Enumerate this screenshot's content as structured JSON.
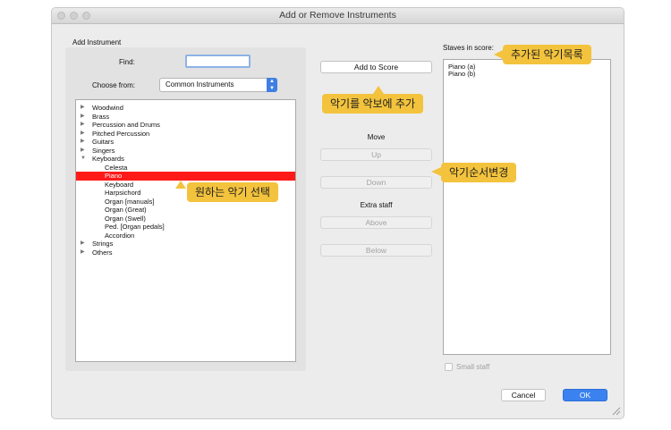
{
  "window": {
    "title": "Add or Remove Instruments"
  },
  "add_instrument": {
    "heading": "Add Instrument",
    "find_label": "Find:",
    "find_value": "",
    "choose_label": "Choose from:",
    "choose_value": "Common Instruments"
  },
  "tree": {
    "items": [
      {
        "label": "Woodwind",
        "level": 0,
        "expanded": false
      },
      {
        "label": "Brass",
        "level": 0,
        "expanded": false
      },
      {
        "label": "Percussion and Drums",
        "level": 0,
        "expanded": false
      },
      {
        "label": "Pitched Percussion",
        "level": 0,
        "expanded": false
      },
      {
        "label": "Guitars",
        "level": 0,
        "expanded": false
      },
      {
        "label": "Singers",
        "level": 0,
        "expanded": false
      },
      {
        "label": "Keyboards",
        "level": 0,
        "expanded": true
      },
      {
        "label": "Celesta",
        "level": 1
      },
      {
        "label": "Piano",
        "level": 1,
        "selected": true
      },
      {
        "label": "Keyboard",
        "level": 1
      },
      {
        "label": "Harpsichord",
        "level": 1
      },
      {
        "label": "Organ [manuals]",
        "level": 1
      },
      {
        "label": "Organ (Great)",
        "level": 1
      },
      {
        "label": "Organ (Swell)",
        "level": 1
      },
      {
        "label": "Ped. [Organ pedals]",
        "level": 1
      },
      {
        "label": "Accordion",
        "level": 1
      },
      {
        "label": "Strings",
        "level": 0,
        "expanded": false
      },
      {
        "label": "Others",
        "level": 0,
        "expanded": false
      }
    ]
  },
  "middle": {
    "add_to_score": "Add to Score",
    "move_label": "Move",
    "up": "Up",
    "down": "Down",
    "extra_staff_label": "Extra staff",
    "above": "Above",
    "below": "Below"
  },
  "staves": {
    "heading": "Staves in score:",
    "items": [
      "Piano (a)",
      "Piano (b)"
    ],
    "small_staff_label": "Small staff",
    "small_staff_checked": false
  },
  "footer": {
    "cancel": "Cancel",
    "ok": "OK"
  },
  "callouts": {
    "added_list": "추가된 악기목록",
    "add_to_score": "악기를 악보에 추가",
    "reorder": "악기순서변경",
    "select_instrument": "원하는 악기 선택"
  },
  "colors": {
    "callout": "#f3c33d",
    "selection": "#ff1a1a",
    "primary": "#3b82f0"
  }
}
